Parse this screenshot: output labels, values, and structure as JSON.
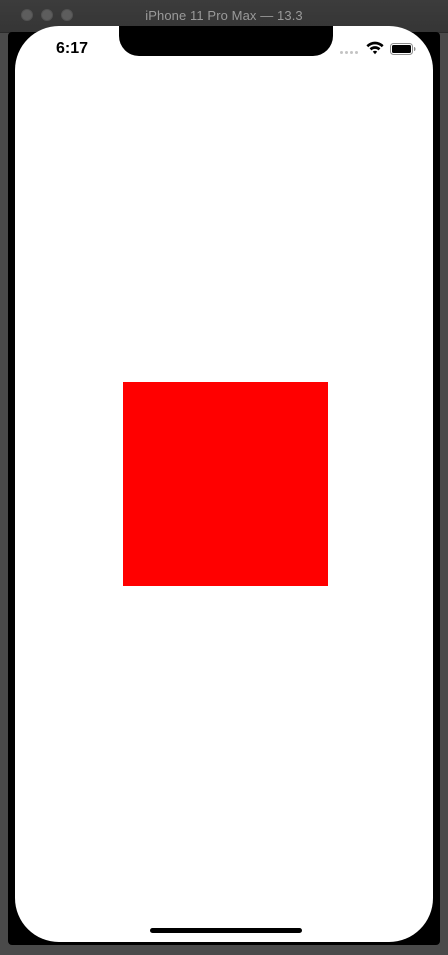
{
  "window": {
    "title": "iPhone 11 Pro Max — 13.3"
  },
  "status_bar": {
    "time": "6:17",
    "icons": [
      "cellular-signal-icon",
      "wifi-icon",
      "battery-icon"
    ]
  },
  "content": {
    "shape": "square",
    "square_color": "#ff0000"
  }
}
